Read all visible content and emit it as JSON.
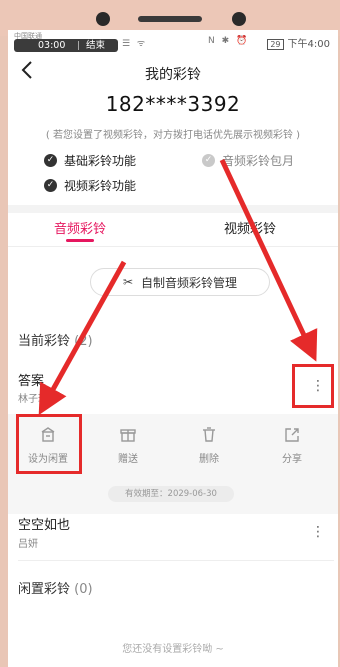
{
  "status": {
    "carrier": "中国联通",
    "rec_time": "03:00",
    "rec_end": "结束",
    "right_time": "下午4:00",
    "battery": "29",
    "left_icons": "☰ ᯤ",
    "right_icons": "N ✱ ⏰"
  },
  "header": {
    "title": "我的彩铃"
  },
  "phone": "182****3392",
  "note": "( 若您设置了视频彩铃，对方拨打电话优先展示视频彩铃 )",
  "features": [
    {
      "label": "基础彩铃功能",
      "enabled": true
    },
    {
      "label": "音频彩铃包月",
      "enabled": false
    },
    {
      "label": "视频彩铃功能",
      "enabled": true
    }
  ],
  "tabs": {
    "audio": "音频彩铃",
    "video": "视频彩铃"
  },
  "diy_button": "自制音频彩铃管理",
  "current": {
    "heading": "当前彩铃",
    "count": "(2)"
  },
  "songs": [
    {
      "title": "答案",
      "artist": "林子琪"
    },
    {
      "title": "空空如也",
      "artist": "吕妍"
    }
  ],
  "actions": [
    {
      "label": "设为闲置",
      "icon": "idle-icon"
    },
    {
      "label": "赠送",
      "icon": "gift-icon"
    },
    {
      "label": "删除",
      "icon": "trash-icon"
    },
    {
      "label": "分享",
      "icon": "share-icon"
    }
  ],
  "valid_until": "有效期至：2029-06-30",
  "idle": {
    "heading": "闲置彩铃",
    "count": "(0)"
  },
  "empty_text": "您还没有设置彩铃呦 ~",
  "colors": {
    "accent": "#e6175f",
    "annotation": "#e52a2a"
  }
}
